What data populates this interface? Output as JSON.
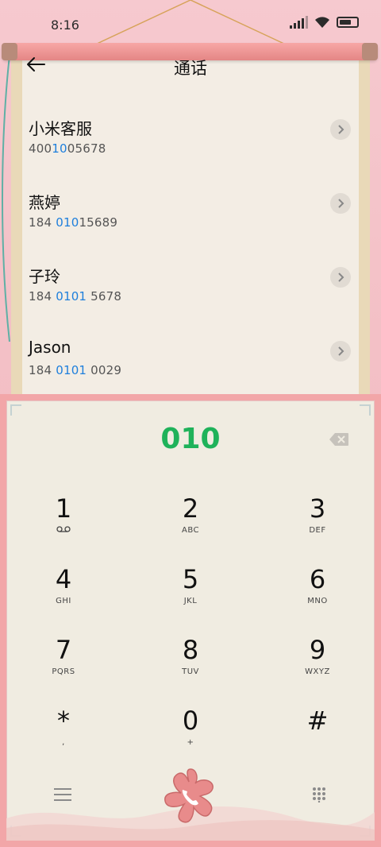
{
  "status_bar": {
    "time": "8:16"
  },
  "header": {
    "title": "通话"
  },
  "contacts": [
    {
      "name": "小米客服",
      "num_pre": "400",
      "num_hl": "10",
      "num_post": "05678"
    },
    {
      "name": "燕婷",
      "num_pre": "184 ",
      "num_hl": "010",
      "num_post": "15689"
    },
    {
      "name": "子玲",
      "num_pre": "184 ",
      "num_hl": "0101",
      "num_post": " 5678"
    },
    {
      "name": "Jason",
      "num_pre": "184 ",
      "num_hl": "0101",
      "num_post": " 0029"
    }
  ],
  "dialer": {
    "digits": "010",
    "keys": [
      {
        "digit": "1",
        "letters": ""
      },
      {
        "digit": "2",
        "letters": "ABC"
      },
      {
        "digit": "3",
        "letters": "DEF"
      },
      {
        "digit": "4",
        "letters": "GHI"
      },
      {
        "digit": "5",
        "letters": "JKL"
      },
      {
        "digit": "6",
        "letters": "MNO"
      },
      {
        "digit": "7",
        "letters": "PQRS"
      },
      {
        "digit": "8",
        "letters": "TUV"
      },
      {
        "digit": "9",
        "letters": "WXYZ"
      },
      {
        "digit": "*",
        "letters": ","
      },
      {
        "digit": "0",
        "letters": "+"
      },
      {
        "digit": "#",
        "letters": ""
      }
    ]
  },
  "colors": {
    "accent_green": "#1fb25a",
    "highlight_blue": "#1e7fdc",
    "call_button": "#e88b8b"
  },
  "icons": [
    "back-arrow-icon",
    "chevron-right-icon",
    "backspace-icon",
    "voicemail-icon",
    "menu-icon",
    "phone-icon",
    "dialpad-icon"
  ]
}
